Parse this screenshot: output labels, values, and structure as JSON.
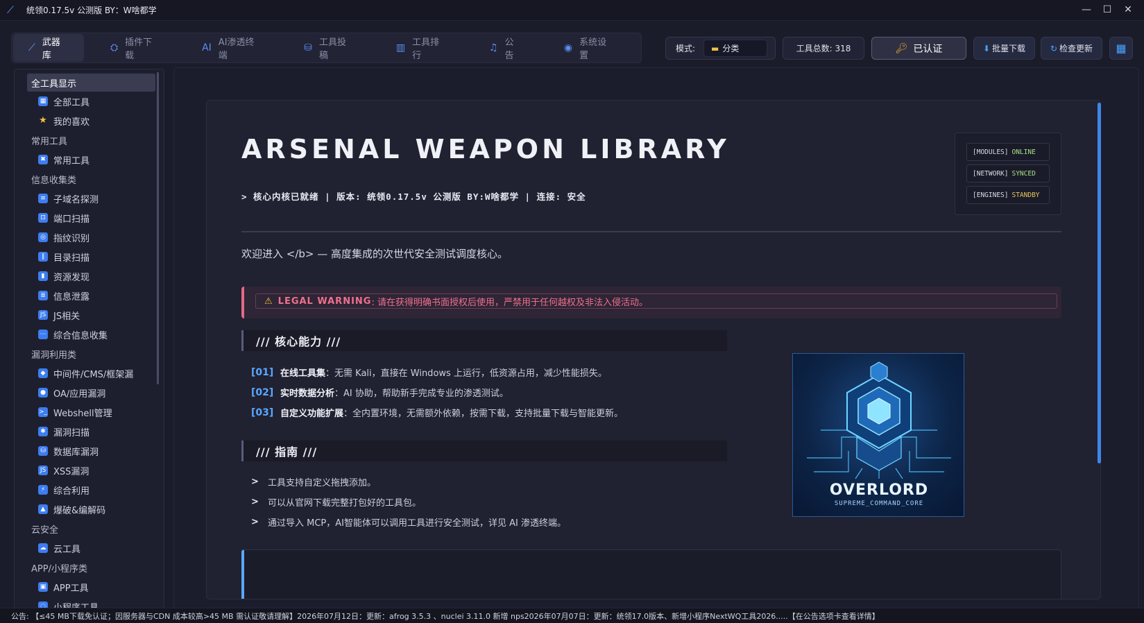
{
  "window": {
    "title": "统领0.17.5v 公测版 BY：W啥都学",
    "controls": [
      "—",
      "☐",
      "✕"
    ]
  },
  "nav": {
    "tabs": [
      {
        "label": "武器库",
        "icon": "sword-icon",
        "glyph": "⟋",
        "active": true
      },
      {
        "label": "插件下载",
        "icon": "plugin-icon",
        "glyph": "⛭",
        "active": false
      },
      {
        "label": "AI渗透终端",
        "icon": "ai-icon",
        "glyph": "AI",
        "active": false
      },
      {
        "label": "工具投稿",
        "icon": "upload-icon",
        "glyph": "⛁",
        "active": false
      },
      {
        "label": "工具排行",
        "icon": "ranking-icon",
        "glyph": "▥",
        "active": false
      },
      {
        "label": "公告",
        "icon": "speaker-icon",
        "glyph": "♫",
        "active": false
      },
      {
        "label": "系统设置",
        "icon": "settings-icon",
        "glyph": "◉",
        "active": false
      }
    ]
  },
  "toolbar": {
    "mode_label": "模式:",
    "mode_value": "分类",
    "tool_count": "工具总数: 318",
    "auth_label": "已认证",
    "batch_download": "批量下载",
    "check_update": "检查更新"
  },
  "sidebar": {
    "items": [
      {
        "type": "cat",
        "label": "全工具显示",
        "selected": true
      },
      {
        "type": "leaf",
        "label": "全部工具",
        "icon": "grid-icon",
        "glyph": "▦"
      },
      {
        "type": "leaf",
        "label": "我的喜欢",
        "icon": "star-icon",
        "glyph": "★"
      },
      {
        "type": "cat",
        "label": "常用工具"
      },
      {
        "type": "leaf",
        "label": "常用工具",
        "icon": "tools-icon",
        "glyph": "✖"
      },
      {
        "type": "cat",
        "label": "信息收集类"
      },
      {
        "type": "leaf",
        "label": "子域名探测",
        "icon": "subdomain-icon",
        "glyph": "≡"
      },
      {
        "type": "leaf",
        "label": "端口扫描",
        "icon": "port-icon",
        "glyph": "⊡"
      },
      {
        "type": "leaf",
        "label": "指纹识别",
        "icon": "fingerprint-icon",
        "glyph": "◎"
      },
      {
        "type": "leaf",
        "label": "目录扫描",
        "icon": "directory-icon",
        "glyph": "∥"
      },
      {
        "type": "leaf",
        "label": "资源发现",
        "icon": "chart-icon",
        "glyph": "▮"
      },
      {
        "type": "leaf",
        "label": "信息泄露",
        "icon": "document-icon",
        "glyph": "≣"
      },
      {
        "type": "leaf",
        "label": "JS相关",
        "icon": "js-icon",
        "glyph": "JS"
      },
      {
        "type": "leaf",
        "label": "综合信息收集",
        "icon": "more-icon",
        "glyph": "⋯"
      },
      {
        "type": "cat",
        "label": "漏洞利用类"
      },
      {
        "type": "leaf",
        "label": "中间件/CMS/框架漏",
        "icon": "middleware-icon",
        "glyph": "◆"
      },
      {
        "type": "leaf",
        "label": "OA/应用漏洞",
        "icon": "oa-icon",
        "glyph": "●"
      },
      {
        "type": "leaf",
        "label": "Webshell管理",
        "icon": "terminal-icon",
        "glyph": ">_"
      },
      {
        "type": "leaf",
        "label": "漏洞扫描",
        "icon": "bug-icon",
        "glyph": "✱"
      },
      {
        "type": "leaf",
        "label": "数据库漏洞",
        "icon": "database-icon",
        "glyph": "⛁"
      },
      {
        "type": "leaf",
        "label": "XSS漏洞",
        "icon": "xss-icon",
        "glyph": "JS"
      },
      {
        "type": "leaf",
        "label": "综合利用",
        "icon": "exploit-icon",
        "glyph": "⚡"
      },
      {
        "type": "leaf",
        "label": "爆破&编解码",
        "icon": "brute-icon",
        "glyph": "▲"
      },
      {
        "type": "cat",
        "label": "云安全"
      },
      {
        "type": "leaf",
        "label": "云工具",
        "icon": "cloud-icon",
        "glyph": "☁"
      },
      {
        "type": "cat",
        "label": "APP/小程序类"
      },
      {
        "type": "leaf",
        "label": "APP工具",
        "icon": "app-icon",
        "glyph": "▣"
      },
      {
        "type": "leaf",
        "label": "小程序工具",
        "icon": "miniprogram-icon",
        "glyph": "◌"
      }
    ]
  },
  "hero": {
    "title": "ARSENAL WEAPON LIBRARY",
    "subtitle": "> 核心内核已就绪 | 版本: 统领0.17.5v 公测版 BY:W啥都学 | 连接: 安全",
    "status": [
      {
        "key": "[MODULES]",
        "value": "ONLINE"
      },
      {
        "key": "[NETWORK]",
        "value": "SYNCED"
      },
      {
        "key": "[ENGINES]",
        "value": "STANDBY"
      }
    ]
  },
  "welcome": "欢迎进入 </b> — 高度集成的次世代安全测试调度核心。",
  "warning": {
    "label": "LEGAL WARNING",
    "text": ": 请在获得明确书面授权后使用，严禁用于任何越权及非法入侵活动。"
  },
  "capabilities": {
    "heading": "/// 核心能力 ///",
    "items": [
      {
        "num": "[01]",
        "key": "在线工具集",
        "text": "：无需 Kali，直接在 Windows 上运行，低资源占用，减少性能损失。"
      },
      {
        "num": "[02]",
        "key": "实时数据分析",
        "text": "：AI 协助，帮助新手完成专业的渗透测试。"
      },
      {
        "num": "[03]",
        "key": "自定义功能扩展",
        "text": "：全内置环境，无需额外依赖，按需下载，支持批量下载与智能更新。"
      }
    ]
  },
  "guide": {
    "heading": "/// 指南 ///",
    "items": [
      {
        "mark": ">",
        "text": "工具支持自定义拖拽添加。"
      },
      {
        "mark": ">",
        "text": "可以从官网下载完整打包好的工具包。"
      },
      {
        "mark": ">",
        "text": "通过导入 MCP，AI智能体可以调用工具进行安全测试，详见 AI 渗透终端。"
      }
    ]
  },
  "logo": {
    "title": "OVERLORD",
    "subtitle": "SUPREME_COMMAND_CORE"
  },
  "statusbar": {
    "text": "公告: 【≤45 MB下载免认证；因服务器与CDN 成本较高>45 MB 需认证敬请理解】2026年07月12日：更新：afrog 3.5.3 、nuclei 3.11.0 新增 nps2026年07月07日：更新：统领17.0版本、新增小程序NextWQ工具2026.....【在公告选项卡查看详情】"
  },
  "colors": {
    "accent": "#4aa3ff",
    "warning": "#f0708c",
    "online": "#a8e08a",
    "standby": "#e6c860",
    "background": "#1b1c2a"
  }
}
